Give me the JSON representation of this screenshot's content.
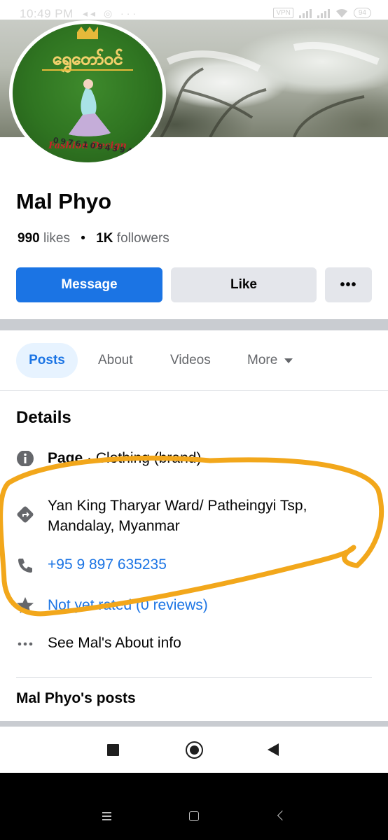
{
  "status_bar": {
    "time": "10:49 PM",
    "vpn_label": "VPN",
    "battery": "94"
  },
  "profile": {
    "name": "Mal Phyo",
    "likes_count": "990",
    "likes_label": "likes",
    "followers_count": "1K",
    "followers_label": "followers",
    "avatar": {
      "logo_title": "ရွှေတော်ဝင်",
      "logo_subtitle": "Fashion Design",
      "logo_phone": "09761094394"
    }
  },
  "actions": {
    "message": "Message",
    "like": "Like",
    "more": "•••"
  },
  "tabs": [
    {
      "label": "Posts",
      "active": true
    },
    {
      "label": "About"
    },
    {
      "label": "Videos"
    },
    {
      "label": "More"
    }
  ],
  "details": {
    "title": "Details",
    "page_label": "Page",
    "page_category": "Clothing (brand)",
    "address": "Yan King Tharyar Ward/ Patheingyi Tsp, Mandalay, Myanmar",
    "phone": "+95 9 897 635235",
    "rating": "Not yet rated (0 reviews)",
    "about_link": "See Mal's About info"
  },
  "posts_section": {
    "title": "Mal Phyo's posts"
  },
  "colors": {
    "accent": "#1b74e4",
    "annotation": "#f2a71b"
  }
}
